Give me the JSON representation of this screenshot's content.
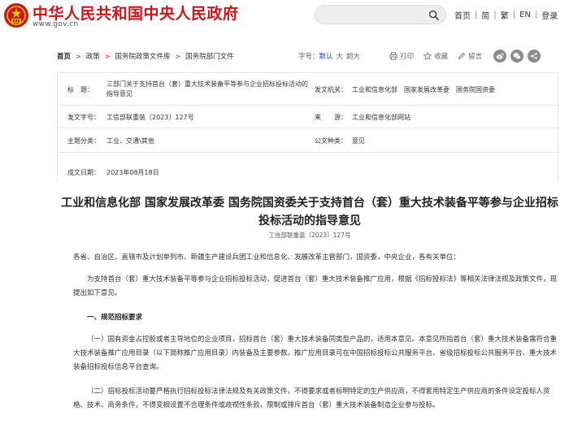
{
  "header": {
    "site_name": "中华人民共和国中央人民政府",
    "site_url": "www.gov.cn",
    "search_placeholder": "",
    "nav": [
      "首页",
      "简",
      "繁",
      "EN",
      "登录"
    ],
    "brand_color": "#c8161d"
  },
  "breadcrumb": {
    "items": [
      "首页",
      "政策",
      "国务院政策文件库",
      "国务院部门文件"
    ]
  },
  "tools": {
    "font_label": "字号：",
    "sizes": [
      "默认",
      "大",
      "超大"
    ],
    "print": "打印",
    "favorite": "收藏",
    "comment": "留言",
    "social_icons": [
      "weibo-icon",
      "wechat-icon",
      "share-icon"
    ]
  },
  "info": {
    "title_label": "标　题：",
    "title_value": "三部门关于支持首台（套）重大技术装备平等参与企业招标投标活动的指导意见",
    "issuer_label": "发文机关：",
    "issuer_value": "工业和信息化部　国家发展改革委　国务院国资委",
    "docno_label": "发文字号：",
    "docno_value": "工信部联重装〔2023〕127号",
    "source_label": "来　　源：",
    "source_value": "工业和信息化部网站",
    "topic_label": "主题分类：",
    "topic_value": "工业、交通\\其他",
    "type_label": "公文种类：",
    "type_value": "意见",
    "date_label": "成文日期：",
    "date_value": "2023年08月18日"
  },
  "article": {
    "title": "工业和信息化部 国家发展改革委 国务院国资委关于支持首台（套）重大技术装备平等参与企业招标投标活动的指导意见",
    "doc_no": "工信部联重装〔2023〕127号",
    "para1": "各省、自治区、直辖市及计划单列市、新疆生产建设兵团工业和信息化、发展改革主管部门，国资委，中央企业，各有关单位：",
    "para2": "为支持首台（套）重大技术装备平等参与企业招标投标活动，促进首台（套）重大技术装备推广应用，根据《招标投标法》等相关法律法规及政策文件，现提出如下意见。",
    "section1": "一、规范招标要求",
    "para3": "（一）国有资金占控股或者主导地位的企业项目，招标首台（套）重大技术装备同类型产品的，适用本意见。本意见所指首台（套）重大技术装备需符合重大技术装备推广应用目录（以下简称推广应用目录）内装备及主要参数。推广应用目录可在中国招标投标公共服务平台、省级招标投标公共服务平台、重大技术装备招标投标信息平台查询。",
    "para4": "（二）招标投标活动要严格执行招标投标法律法规及有关政策文件，不得要求或者标明特定的生产供应商，不得套用特定生产供应商的条件设定投标人资格、技术、商务条件，不得变相设置不合理条件或歧视性条款，限制或排斥首台（套）重大技术装备制造企业参与投标。"
  }
}
